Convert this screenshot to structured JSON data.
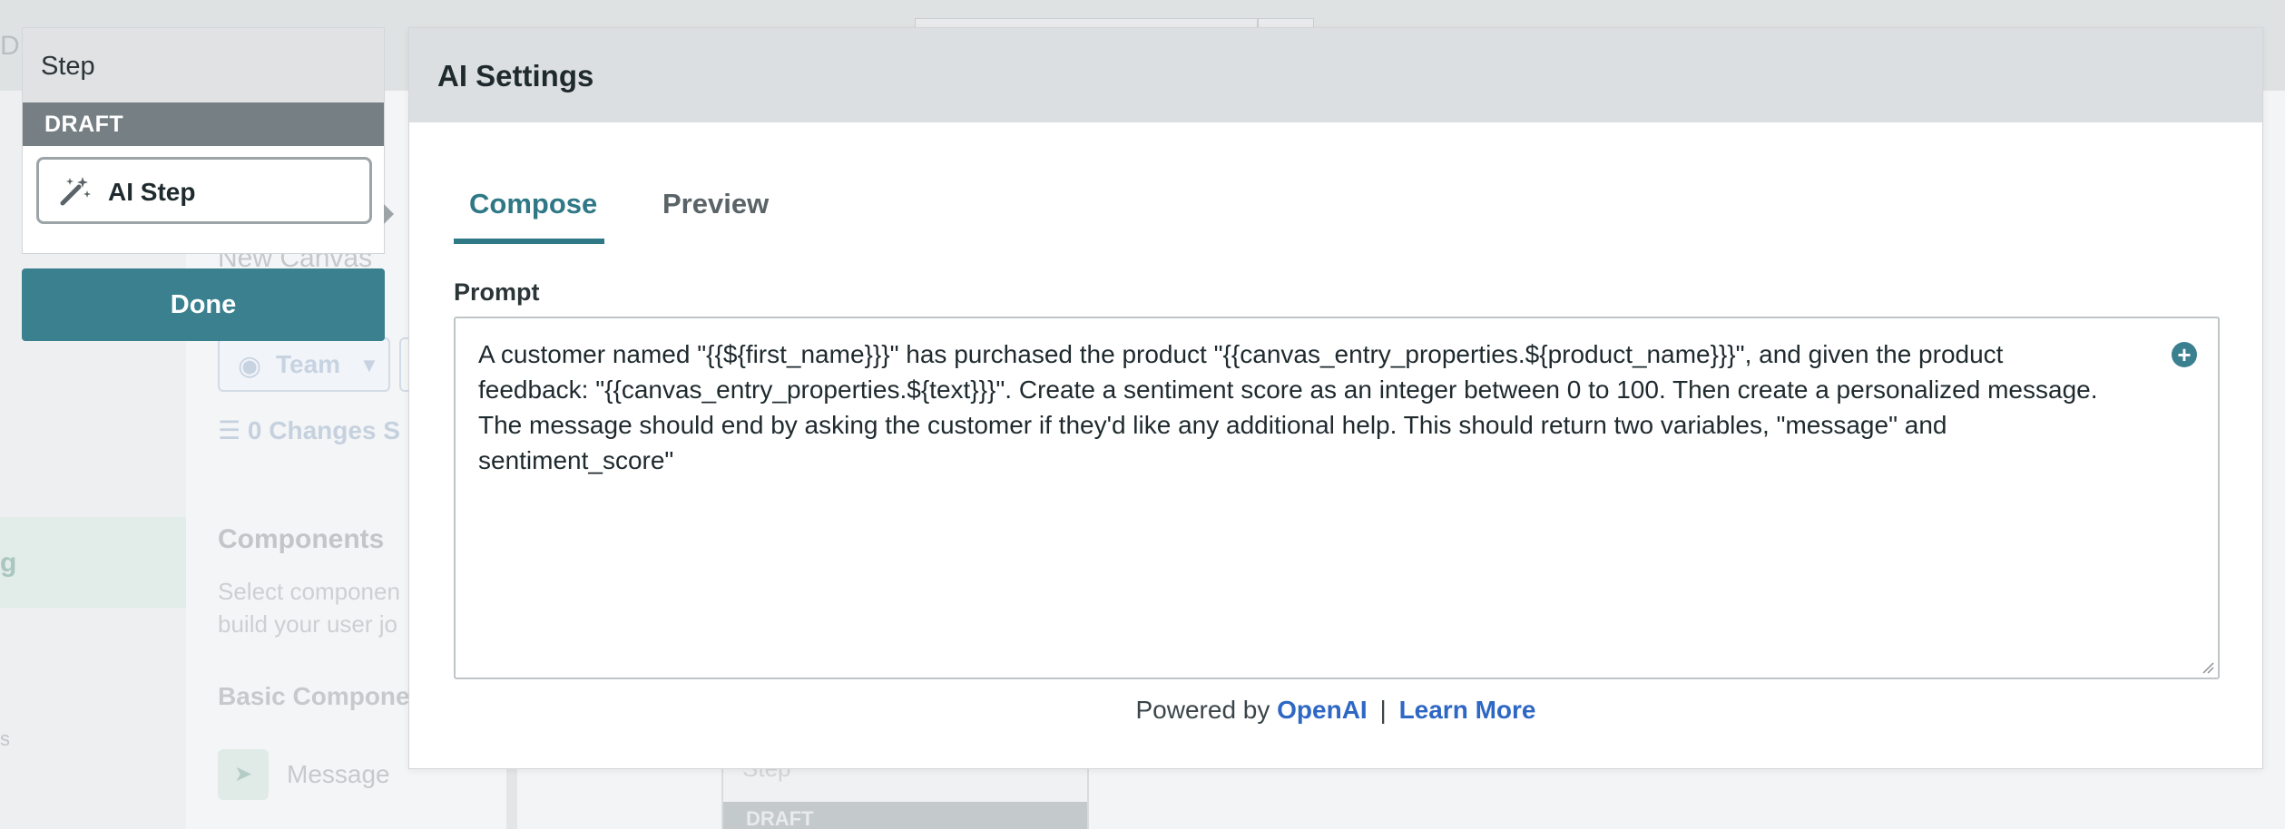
{
  "background": {
    "top_edge_text": "D",
    "canvas_name": "New Canvas",
    "team_select": "Team",
    "changes": "0 Changes S",
    "nav_active": "g",
    "nav_small": "s",
    "components_title": "Components",
    "components_desc": "Select componen build your user jo",
    "basic_components_title": "Basic Compone",
    "message_item": "Message",
    "step_card_label": "Step",
    "step_card_draft": "DRAFT"
  },
  "step_panel": {
    "header": "Step",
    "status": "DRAFT",
    "node_label": "AI Step",
    "node_icon": "magic-wand-icon"
  },
  "done_button": "Done",
  "modal": {
    "title": "AI Settings",
    "tabs": [
      {
        "label": "Compose",
        "active": true
      },
      {
        "label": "Preview",
        "active": false
      }
    ],
    "prompt_label": "Prompt",
    "prompt_value": "A customer named \"{{${first_name}}}\" has purchased the product \"{{canvas_entry_properties.${product_name}}}\", and given the product feedback: \"{{canvas_entry_properties.${text}}}\". Create a sentiment score as an integer between 0 to 100. Then create a personalized message. The message should end by asking the customer if they'd like any additional help. This should return two variables, \"message\" and sentiment_score\"",
    "add_icon": "plus-circle-icon",
    "footer": {
      "prefix": "Powered by",
      "provider_link": "OpenAI",
      "separator": "|",
      "learn_more_link": "Learn More"
    }
  },
  "colors": {
    "accent_teal": "#3a808f",
    "tab_active": "#2f7886",
    "link_blue": "#2e67c4",
    "draft_gray": "#767f84"
  }
}
